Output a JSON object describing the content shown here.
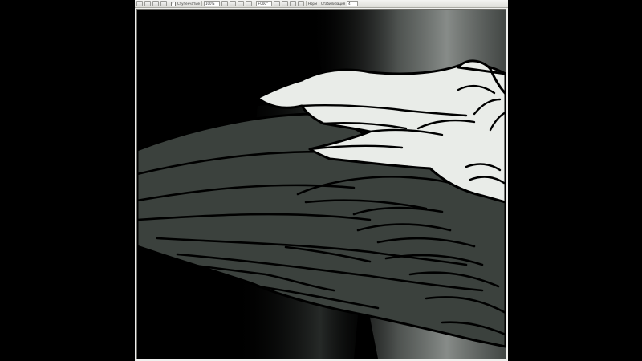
{
  "toolbar": {
    "antialias_label": "Ступенчатые",
    "zoom_value": "100%",
    "rotation_value": "+000°",
    "mode_label": "Норм",
    "stabilizer_label": "Стабилизация",
    "stabilizer_value": "4",
    "check_mark": "✓"
  },
  "canvas": {
    "background_color": "#000000",
    "light_shaft_color": "#9ba39e",
    "dark_feather_color": "#3b413d",
    "light_feather_color": "#e9ece8",
    "line_color": "#000000"
  }
}
